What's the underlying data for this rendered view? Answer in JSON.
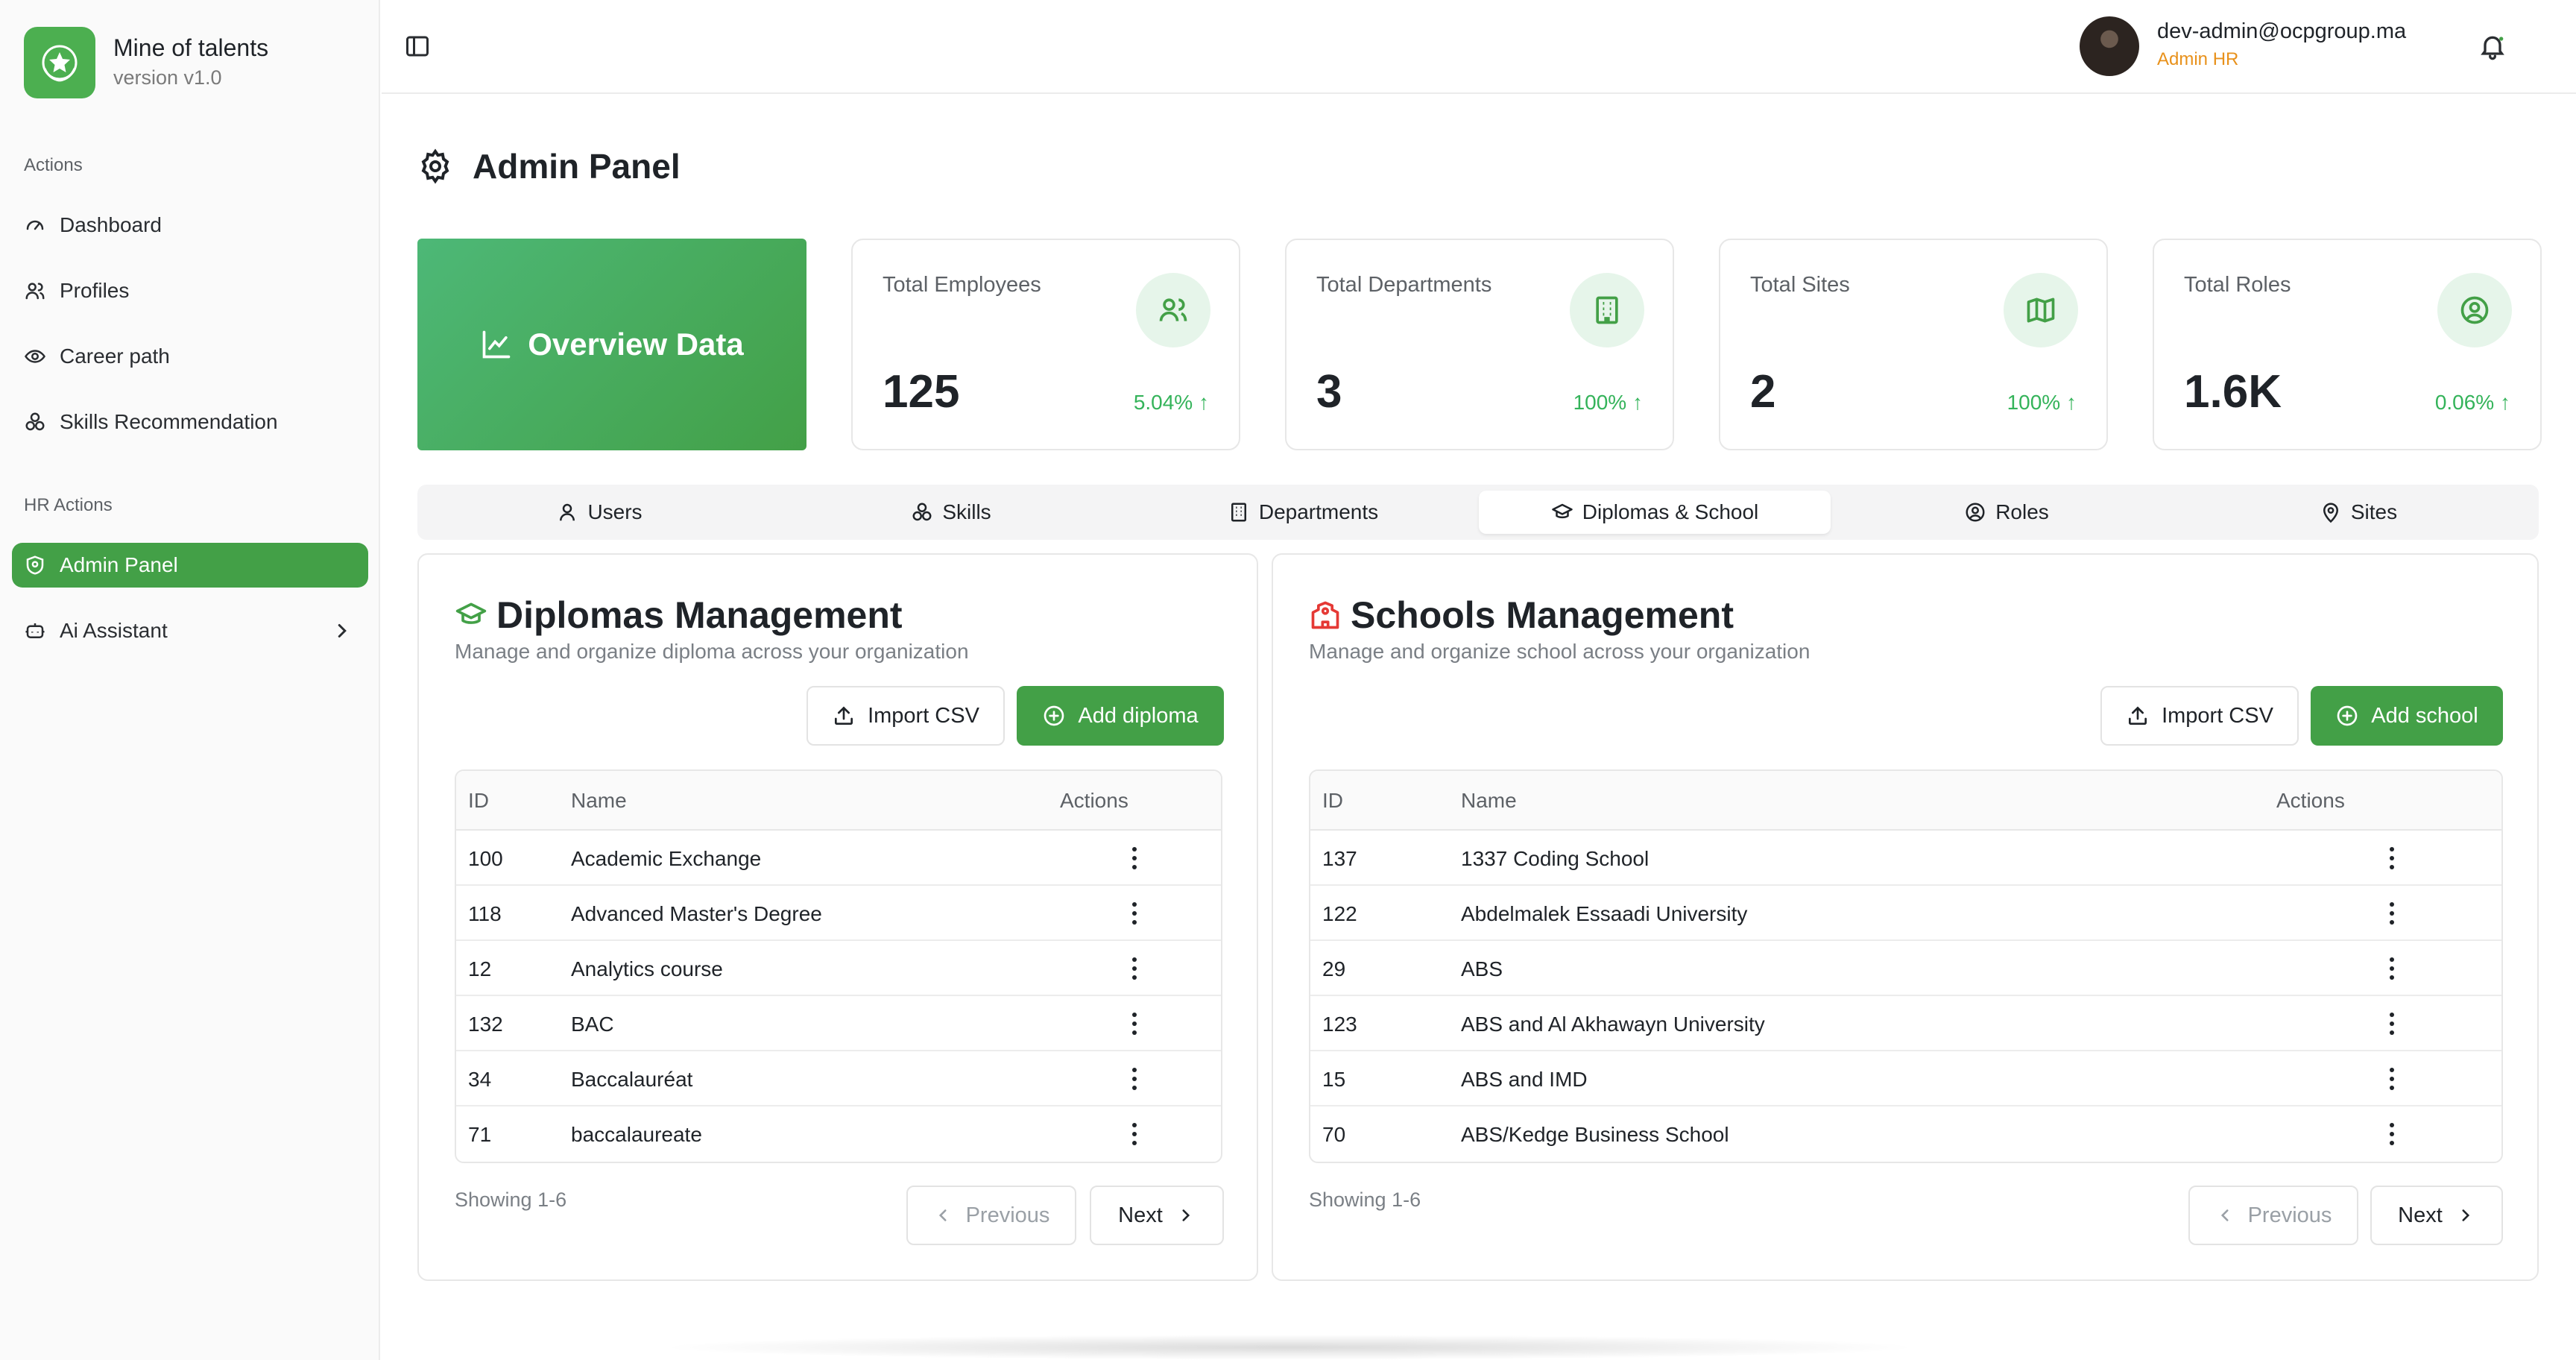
{
  "app": {
    "name": "Mine of talents",
    "version": "version v1.0"
  },
  "sidebar": {
    "sections": [
      {
        "label": "Actions",
        "items": [
          {
            "label": "Dashboard",
            "icon": "gauge-icon"
          },
          {
            "label": "Profiles",
            "icon": "users-icon"
          },
          {
            "label": "Career path",
            "icon": "eye-icon"
          },
          {
            "label": "Skills Recommendation",
            "icon": "boxes-icon"
          }
        ]
      },
      {
        "label": "HR Actions",
        "items": [
          {
            "label": "Admin Panel",
            "icon": "shield-icon",
            "active": true
          },
          {
            "label": "Ai Assistant",
            "icon": "bot-icon",
            "has_submenu": true
          }
        ]
      }
    ]
  },
  "user": {
    "email": "dev-admin@ocpgroup.ma",
    "role": "Admin HR"
  },
  "page": {
    "title": "Admin Panel"
  },
  "overview": {
    "label": "Overview Data"
  },
  "stats": [
    {
      "label": "Total Employees",
      "value": "125",
      "delta": "5.04%",
      "icon": "users-icon"
    },
    {
      "label": "Total Departments",
      "value": "3",
      "delta": "100%",
      "icon": "building-icon"
    },
    {
      "label": "Total Sites",
      "value": "2",
      "delta": "100%",
      "icon": "map-icon"
    },
    {
      "label": "Total Roles",
      "value": "1.6K",
      "delta": "0.06%",
      "icon": "user-circle-icon"
    }
  ],
  "tabs": [
    {
      "label": "Users",
      "icon": "user-icon"
    },
    {
      "label": "Skills",
      "icon": "boxes-icon"
    },
    {
      "label": "Departments",
      "icon": "building-icon"
    },
    {
      "label": "Diplomas & School",
      "icon": "graduation-cap-icon",
      "active": true
    },
    {
      "label": "Roles",
      "icon": "user-circle-icon"
    },
    {
      "label": "Sites",
      "icon": "map-pin-icon"
    }
  ],
  "diplomas": {
    "title": "Diplomas Management",
    "description": "Manage and organize diploma across your organization",
    "import_label": "Import CSV",
    "add_label": "Add diploma",
    "columns": [
      "ID",
      "Name",
      "Actions"
    ],
    "rows": [
      {
        "id": "100",
        "name": "Academic Exchange"
      },
      {
        "id": "118",
        "name": "Advanced Master's Degree"
      },
      {
        "id": "12",
        "name": "Analytics course"
      },
      {
        "id": "132",
        "name": "BAC"
      },
      {
        "id": "34",
        "name": "Baccalauréat"
      },
      {
        "id": "71",
        "name": "baccalaureate"
      }
    ],
    "showing": "Showing 1-6",
    "prev_label": "Previous",
    "next_label": "Next"
  },
  "schools": {
    "title": "Schools Management",
    "description": "Manage and organize school across your organization",
    "import_label": "Import CSV",
    "add_label": "Add school",
    "columns": [
      "ID",
      "Name",
      "Actions"
    ],
    "rows": [
      {
        "id": "137",
        "name": "1337 Coding School"
      },
      {
        "id": "122",
        "name": "Abdelmalek Essaadi University"
      },
      {
        "id": "29",
        "name": "ABS"
      },
      {
        "id": "123",
        "name": "ABS and Al Akhawayn University"
      },
      {
        "id": "15",
        "name": "ABS and IMD"
      },
      {
        "id": "70",
        "name": "ABS/Kedge Business School"
      }
    ],
    "showing": "Showing 1-6",
    "prev_label": "Previous",
    "next_label": "Next"
  },
  "colors": {
    "accent": "#43a047",
    "role": "#e8911b",
    "delta": "#34b35a",
    "school_icon": "#e53935"
  }
}
